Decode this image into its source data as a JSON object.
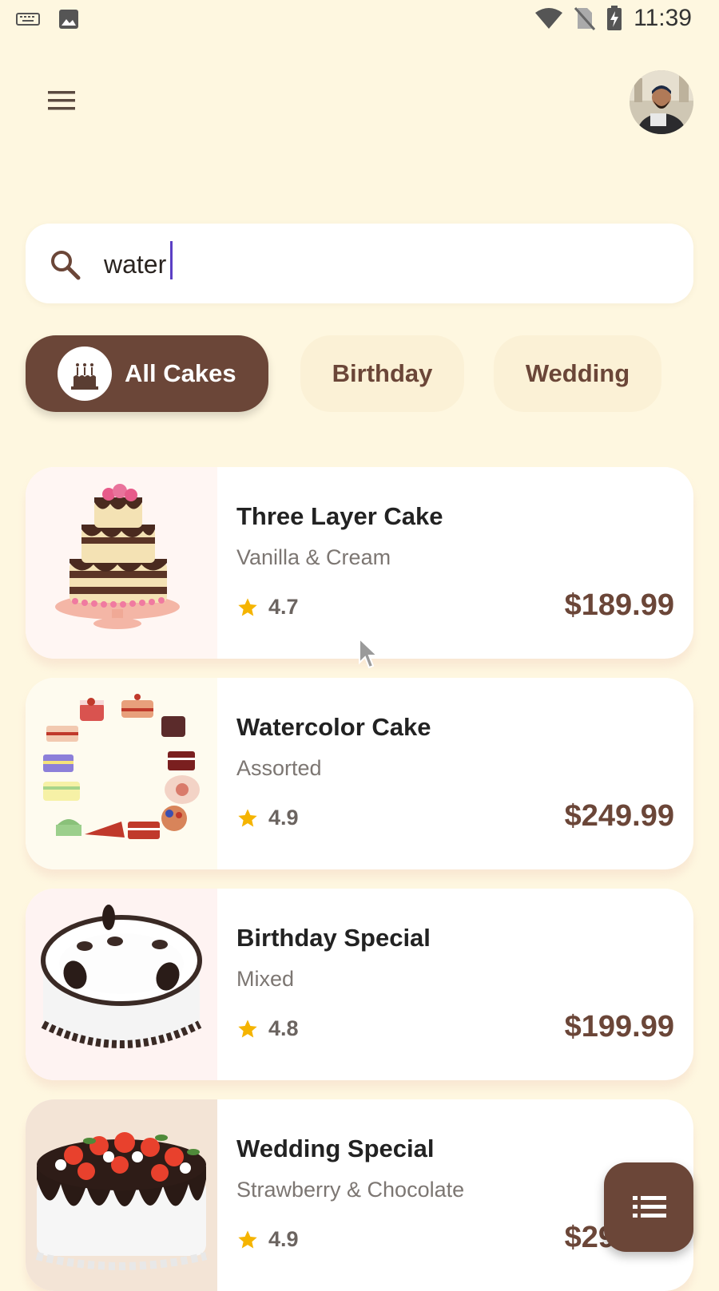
{
  "status_bar": {
    "time": "11:39",
    "left_icons": [
      "keyboard-icon",
      "image-icon"
    ],
    "right_icons": [
      "wifi-icon",
      "no-sim-icon",
      "battery-charging-icon"
    ]
  },
  "header": {
    "menu_icon": "menu-icon",
    "avatar": "user-avatar"
  },
  "search": {
    "value": "water",
    "icon": "search-icon"
  },
  "categories": [
    {
      "label": "All Cakes",
      "active": true,
      "icon": "cake-icon"
    },
    {
      "label": "Birthday",
      "active": false
    },
    {
      "label": "Wedding",
      "active": false
    }
  ],
  "cakes": [
    {
      "title": "Three Layer Cake",
      "subtitle": "Vanilla & Cream",
      "rating": "4.7",
      "price": "$189.99",
      "bg": "#FFF6F3"
    },
    {
      "title": "Watercolor Cake",
      "subtitle": "Assorted",
      "rating": "4.9",
      "price": "$249.99",
      "bg": "#FEFBEF"
    },
    {
      "title": "Birthday Special",
      "subtitle": "Mixed",
      "rating": "4.8",
      "price": "$199.99",
      "bg": "#FEF3F2"
    },
    {
      "title": "Wedding Special",
      "subtitle": "Strawberry & Chocolate",
      "rating": "4.9",
      "price": "$299.99",
      "bg": "#F3E4D6"
    }
  ],
  "fab": {
    "icon": "list-icon"
  },
  "colors": {
    "background": "#FEF7E0",
    "primary": "#6B4638",
    "chip_inactive": "#FBF1D6",
    "star": "#F5B400",
    "caret": "#5B3FC4"
  }
}
